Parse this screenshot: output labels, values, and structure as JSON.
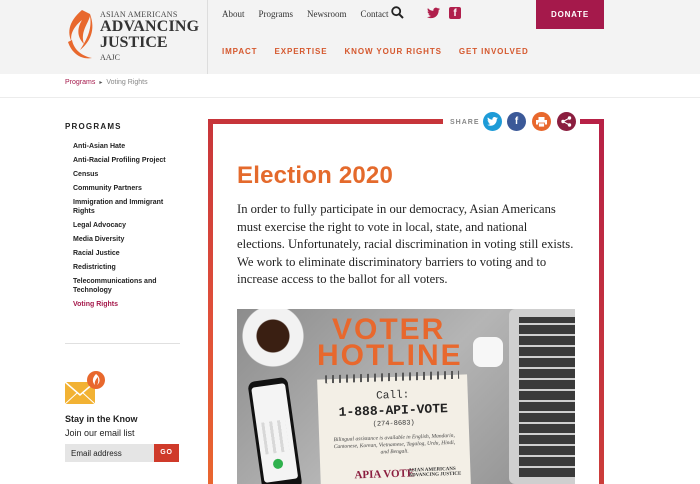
{
  "header": {
    "logo": {
      "line1": "ASIAN AMERICANS",
      "line2": "ADVANCING",
      "line3": "JUSTICE",
      "line4": "AAJC"
    },
    "top_links": [
      "About",
      "Programs",
      "Newsroom",
      "Contact"
    ],
    "donate_label": "DONATE",
    "main_nav": [
      "IMPACT",
      "EXPERTISE",
      "KNOW YOUR RIGHTS",
      "GET INVOLVED"
    ]
  },
  "breadcrumb": {
    "parent": "Programs",
    "current": "Voting Rights"
  },
  "sidebar": {
    "title": "PROGRAMS",
    "items": [
      "Anti-Asian Hate",
      "Anti-Racial Profiling Project",
      "Census",
      "Community Partners",
      "Immigration and Immigrant Rights",
      "Legal Advocacy",
      "Media Diversity",
      "Racial Justice",
      "Redistricting",
      "Telecommunications and Technology",
      "Voting Rights"
    ],
    "active_item": "Voting Rights",
    "newsletter": {
      "title": "Stay in the Know",
      "subtitle": "Join our email list",
      "placeholder": "Email address",
      "go_label": "GO"
    }
  },
  "share": {
    "label": "SHARE"
  },
  "main": {
    "heading": "Election 2020",
    "intro": "In order to fully participate in our democracy, Asian Americans must exercise the right to vote in local, state, and national elections. Unfortunately, racial discrimination in voting still exists. We work to eliminate discriminatory barriers to voting and to increase access to the ballot for all voters."
  },
  "hotline_image": {
    "title_line1": "VOTER",
    "title_line2": "HOTLINE",
    "call_label": "Call:",
    "phone": "1-888-API-VOTE",
    "phone_digits": "(274-8683)",
    "fine_print": "Bilingual assistance is available in English, Mandarin, Cantonese, Korean, Vietnamese, Tagalog, Urdu, Hindi, and Bengali.",
    "org1": "APIA VOTE",
    "org2": "ASIAN AMERICANS ADVANCING JUSTICE"
  },
  "colors": {
    "accent_orange": "#e46a2c",
    "brand_crimson": "#a5194b",
    "twitter_blue": "#1d9bd7",
    "facebook_blue": "#3b5998"
  }
}
